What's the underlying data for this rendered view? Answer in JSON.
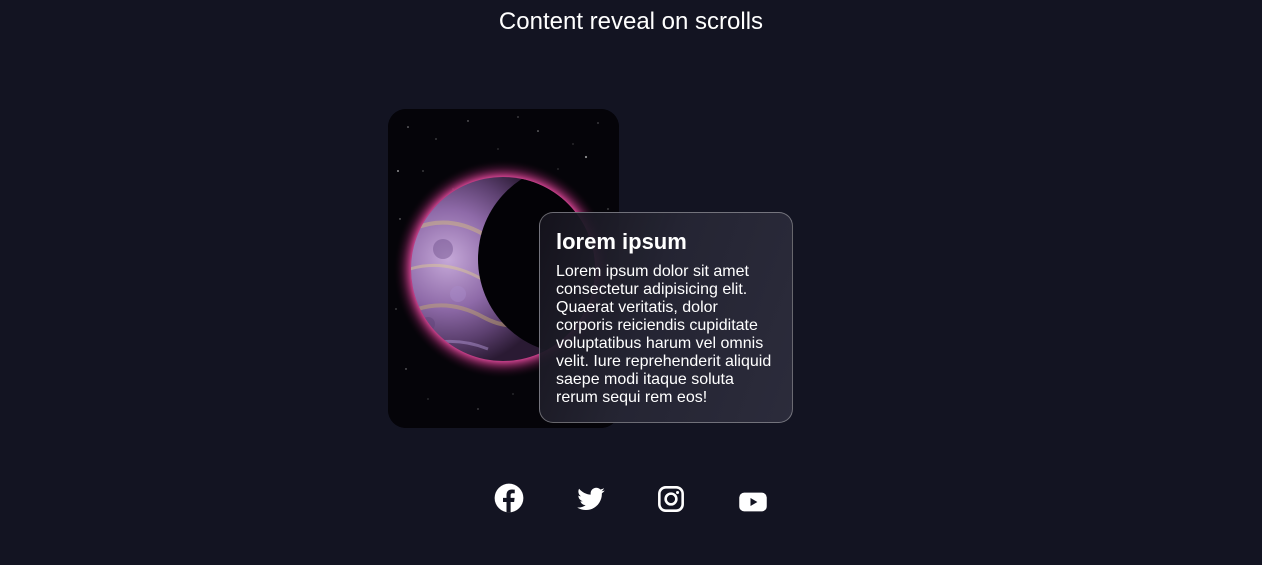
{
  "page": {
    "title": "Content reveal on scrolls",
    "background": "#131422"
  },
  "card": {
    "image_subject": "planet-in-space",
    "heading": "lorem ipsum",
    "body": "Lorem ipsum dolor sit amet consectetur adipisicing elit. Quaerat veritatis, dolor corporis reiciendis cupiditate voluptatibus harum vel omnis velit. Iure reprehenderit aliquid saepe modi itaque soluta rerum sequi rem eos!"
  },
  "social": [
    {
      "icon": "facebook-icon"
    },
    {
      "icon": "twitter-icon"
    },
    {
      "icon": "instagram-icon"
    },
    {
      "icon": "youtube-icon"
    }
  ],
  "colors": {
    "text": "#ffffff",
    "planet_glow": "#d23a8a",
    "planet_surface": "#9b7cc4"
  }
}
